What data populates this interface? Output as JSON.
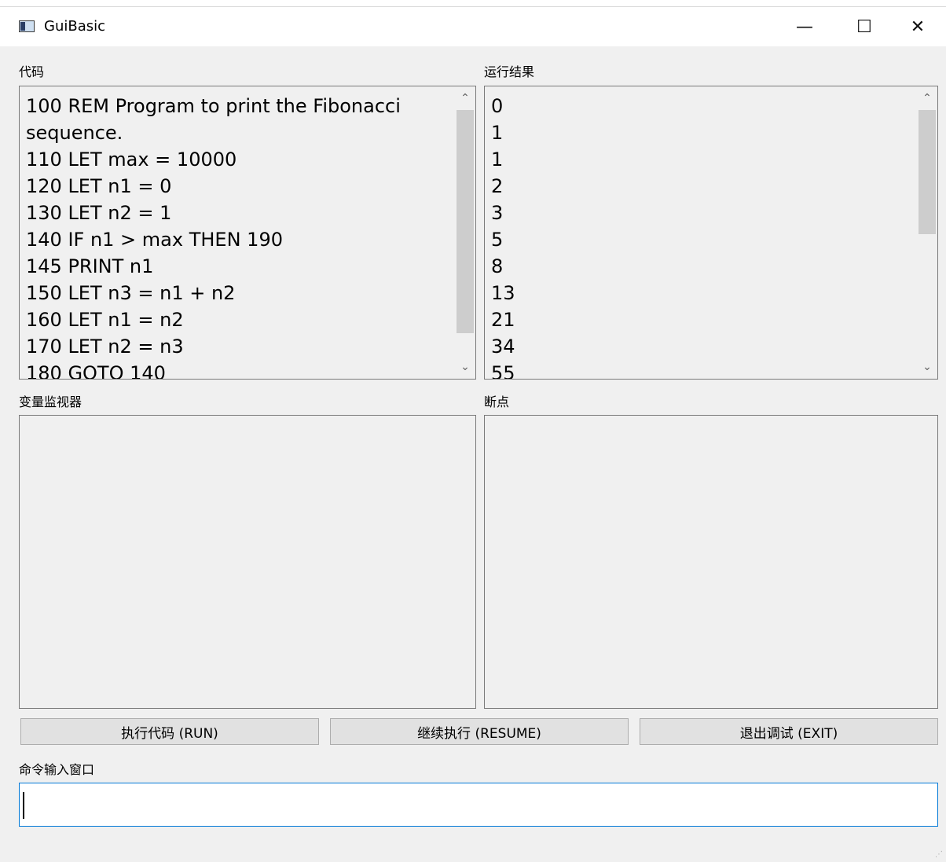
{
  "window": {
    "title": "GuiBasic",
    "minimize_glyph": "—",
    "maximize_glyph": "☐",
    "close_glyph": "✕"
  },
  "code_panel": {
    "label": "代码",
    "lines": [
      "100 REM Program to print the Fibonacci",
      "sequence.",
      "110 LET max = 10000",
      "120 LET n1 = 0",
      "130 LET n2 = 1",
      "140 IF n1 > max THEN 190",
      "145 PRINT n1",
      "150 LET n3 = n1 + n2",
      "160 LET n1 = n2",
      "170 LET n2 = n3",
      "180 GOTO 140"
    ]
  },
  "output_panel": {
    "label": "运行结果",
    "lines": [
      "0",
      "1",
      "1",
      "2",
      "3",
      "5",
      "8",
      "13",
      "21",
      "34",
      "55"
    ]
  },
  "variable_panel": {
    "label": "变量监视器"
  },
  "breakpoint_panel": {
    "label": "断点"
  },
  "buttons": {
    "run": "执行代码 (RUN)",
    "resume": "继续执行 (RESUME)",
    "exit": "退出调试 (EXIT)"
  },
  "command": {
    "label": "命令输入窗口",
    "value": ""
  },
  "icons": {
    "scroll_up": "chevron-up-icon",
    "scroll_down": "chevron-down-icon"
  }
}
